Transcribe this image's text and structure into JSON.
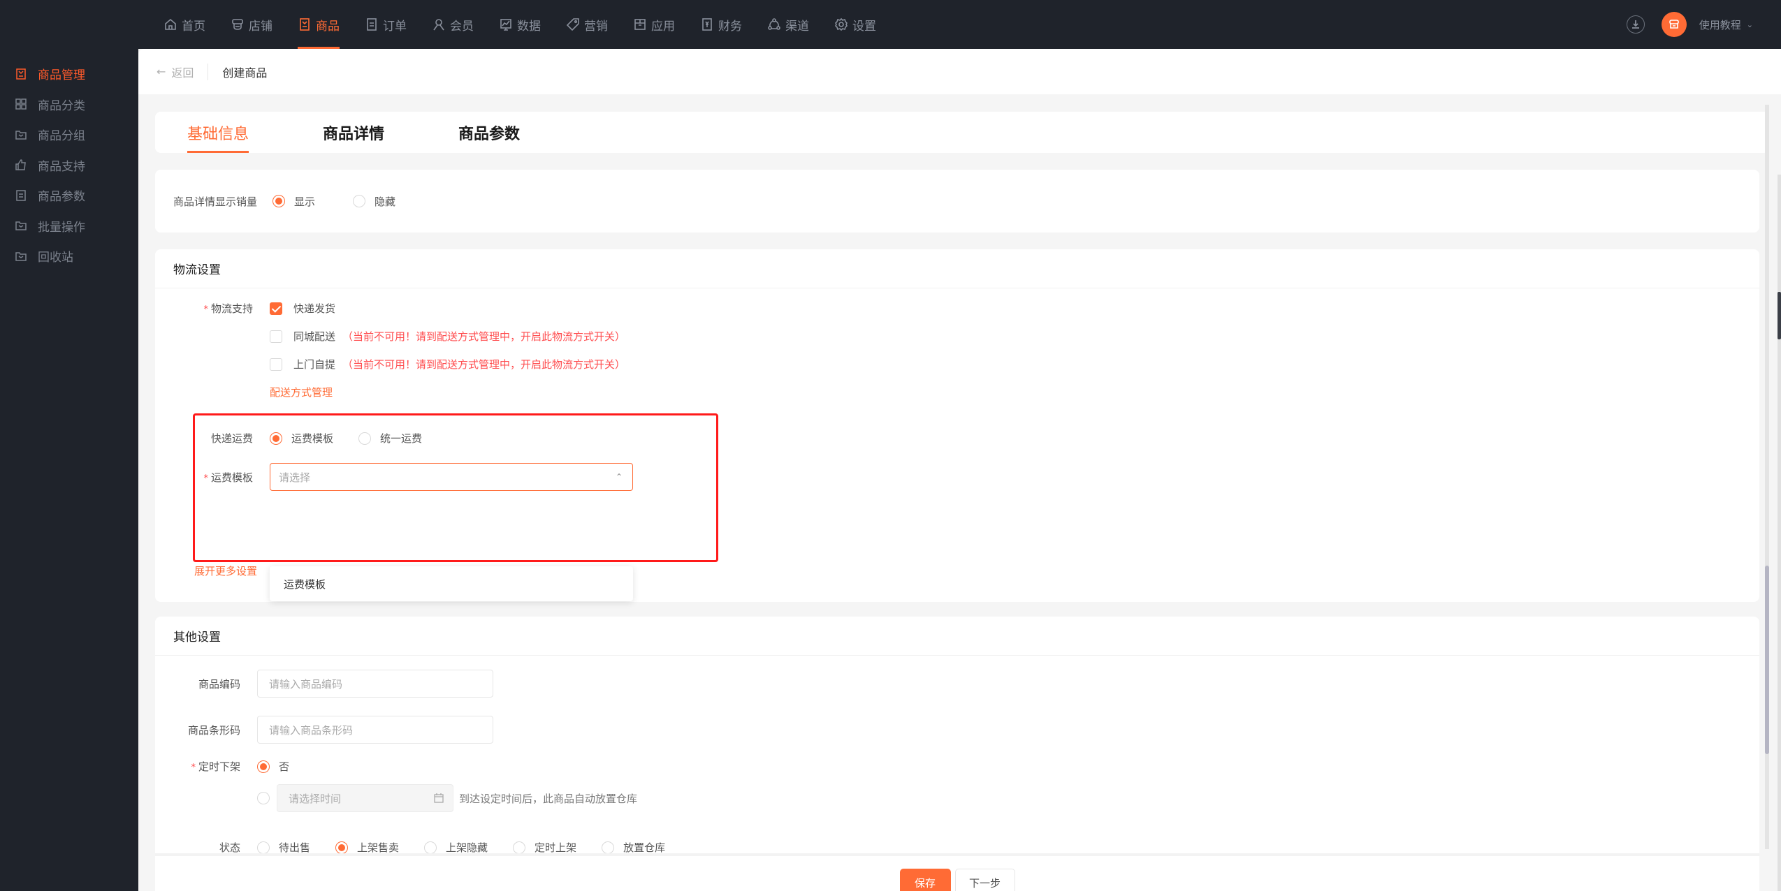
{
  "topnav": {
    "items": [
      {
        "label": "首页",
        "icon": "home-icon"
      },
      {
        "label": "店铺",
        "icon": "store-icon"
      },
      {
        "label": "商品",
        "icon": "goods-icon",
        "active": true
      },
      {
        "label": "订单",
        "icon": "order-icon"
      },
      {
        "label": "会员",
        "icon": "member-icon"
      },
      {
        "label": "数据",
        "icon": "chart-icon"
      },
      {
        "label": "营销",
        "icon": "tag-icon"
      },
      {
        "label": "应用",
        "icon": "box-icon"
      },
      {
        "label": "财务",
        "icon": "finance-icon"
      },
      {
        "label": "渠道",
        "icon": "channel-icon"
      },
      {
        "label": "设置",
        "icon": "gear-icon"
      }
    ],
    "tutorial_label": "使用教程",
    "accent": "#ff6b35"
  },
  "sidebar": {
    "items": [
      {
        "label": "商品管理",
        "icon": "goods-icon",
        "active": true
      },
      {
        "label": "商品分类",
        "icon": "grid-icon"
      },
      {
        "label": "商品分组",
        "icon": "folder-icon"
      },
      {
        "label": "商品支持",
        "icon": "thumb-up-icon"
      },
      {
        "label": "商品参数",
        "icon": "document-icon"
      },
      {
        "label": "批量操作",
        "icon": "folder-icon"
      },
      {
        "label": "回收站",
        "icon": "folder-icon"
      }
    ]
  },
  "breadcrumb": {
    "back_label": "返回",
    "title": "创建商品"
  },
  "tabs": [
    {
      "label": "基础信息",
      "active": true
    },
    {
      "label": "商品详情"
    },
    {
      "label": "商品参数"
    }
  ],
  "sales_display": {
    "label": "商品详情显示销量",
    "options": [
      {
        "label": "显示",
        "selected": true
      },
      {
        "label": "隐藏",
        "selected": false
      }
    ]
  },
  "logistics": {
    "title": "物流设置",
    "support_label": "物流支持",
    "options": [
      {
        "label": "快递发货",
        "checked": true,
        "warning": ""
      },
      {
        "label": "同城配送",
        "checked": false,
        "warning": "（当前不可用！请到配送方式管理中，开启此物流方式开关）"
      },
      {
        "label": "上门自提",
        "checked": false,
        "warning": "（当前不可用！请到配送方式管理中，开启此物流方式开关）"
      }
    ],
    "manage_link": "配送方式管理",
    "fee_label": "快递运费",
    "fee_options": [
      {
        "label": "运费模板",
        "selected": true
      },
      {
        "label": "统一运费",
        "selected": false
      }
    ],
    "template_label": "运费模板",
    "template_placeholder": "请选择",
    "template_dropdown_options": [
      "运费模板"
    ],
    "expand_link": "展开更多设置"
  },
  "other": {
    "title": "其他设置",
    "code_label": "商品编码",
    "code_placeholder": "请输入商品编码",
    "barcode_label": "商品条形码",
    "barcode_placeholder": "请输入商品条形码",
    "offshelf_label": "定时下架",
    "offshelf_no": "否",
    "offshelf_time_placeholder": "请选择时间",
    "offshelf_hint": "到达设定时间后，此商品自动放置仓库",
    "status_label": "状态",
    "status_options": [
      {
        "label": "待出售",
        "selected": false
      },
      {
        "label": "上架售卖",
        "selected": true
      },
      {
        "label": "上架隐藏",
        "selected": false
      },
      {
        "label": "定时上架",
        "selected": false
      },
      {
        "label": "放置仓库",
        "selected": false
      }
    ]
  },
  "footer": {
    "save_label": "保存",
    "next_label": "下一步"
  }
}
